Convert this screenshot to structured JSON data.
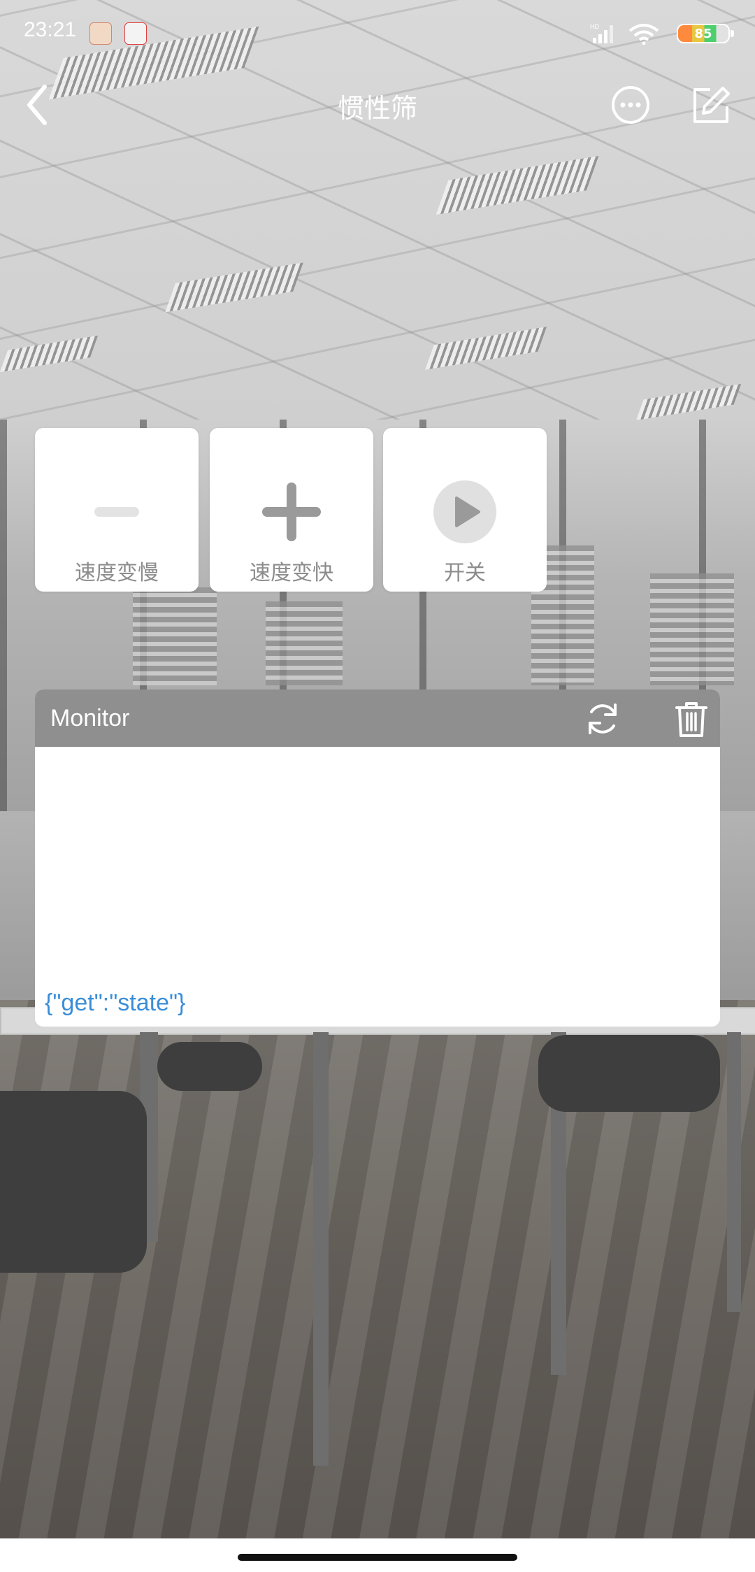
{
  "status_bar": {
    "time": "23:21",
    "battery_level": "85",
    "network_label": "HD",
    "icons": [
      "app-notification-icon",
      "app-notification-icon-2",
      "signal-icon",
      "wifi-icon",
      "battery-icon"
    ]
  },
  "nav": {
    "title": "惯性筛",
    "icons": [
      "back-arrow-icon",
      "more-icon",
      "edit-icon"
    ]
  },
  "controls": [
    {
      "label": "速度变慢",
      "icon": "minus-icon"
    },
    {
      "label": "速度变快",
      "icon": "plus-icon"
    },
    {
      "label": "开关",
      "icon": "play-icon"
    }
  ],
  "monitor": {
    "title": "Monitor",
    "icons": [
      "refresh-icon",
      "trash-icon"
    ],
    "log": [
      "{\"get\":\"state\"}"
    ]
  },
  "colors": {
    "monitor_header": "#8f8f8f",
    "tile_icon": "#9a9a9a",
    "log_text": "#3a8ed8",
    "tile_label": "#8c8c8c"
  }
}
